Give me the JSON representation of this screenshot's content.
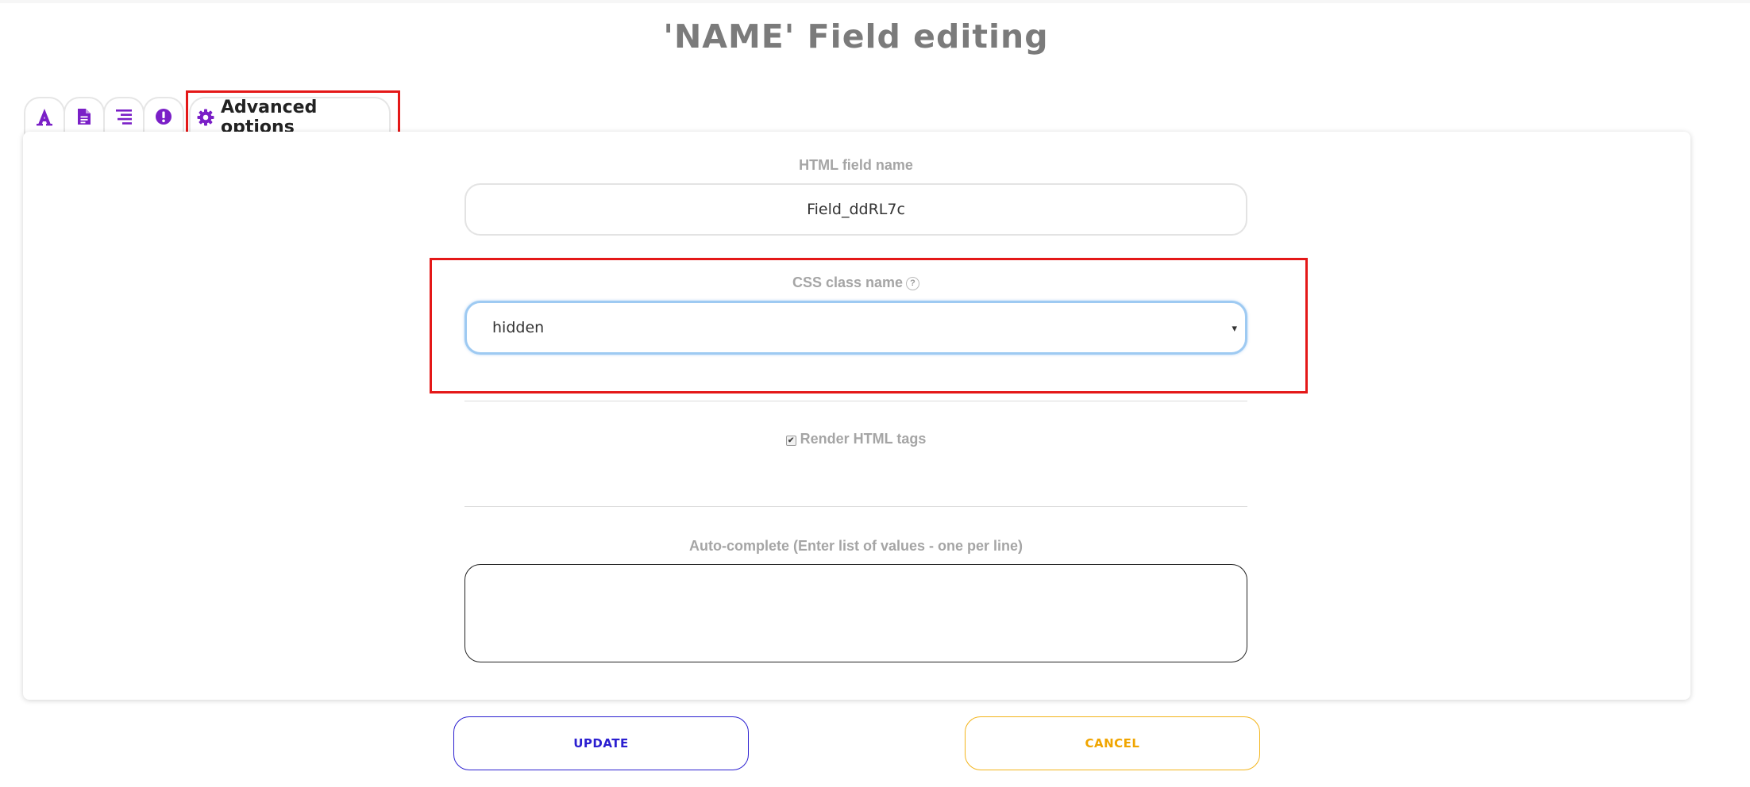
{
  "page": {
    "title": "'NAME' Field editing"
  },
  "tabs": [
    {
      "icon": "font-icon"
    },
    {
      "icon": "file-text-icon"
    },
    {
      "icon": "align-right-icon"
    },
    {
      "icon": "exclamation-circle-icon"
    },
    {
      "icon": "gear-icon",
      "label": "Advanced options",
      "active": true
    }
  ],
  "form": {
    "html_field_name": {
      "label": "HTML field name",
      "value": "Field_ddRL7c"
    },
    "css_class_name": {
      "label": "CSS class name",
      "help": "?",
      "value": "hidden",
      "caret": "▾"
    },
    "render_html_tags": {
      "label": "Render HTML tags",
      "checked": true,
      "check_glyph": "✔"
    },
    "auto_complete": {
      "label": "Auto-complete (Enter list of values - one per line)",
      "value": ""
    }
  },
  "buttons": {
    "update": "UPDATE",
    "cancel": "CANCEL"
  },
  "colors": {
    "accent_purple": "#7a1fc7",
    "highlight_red": "#e41818",
    "update_blue": "#2b1fd0",
    "cancel_orange": "#f0a500",
    "focus_blue": "#9ecaf2"
  }
}
